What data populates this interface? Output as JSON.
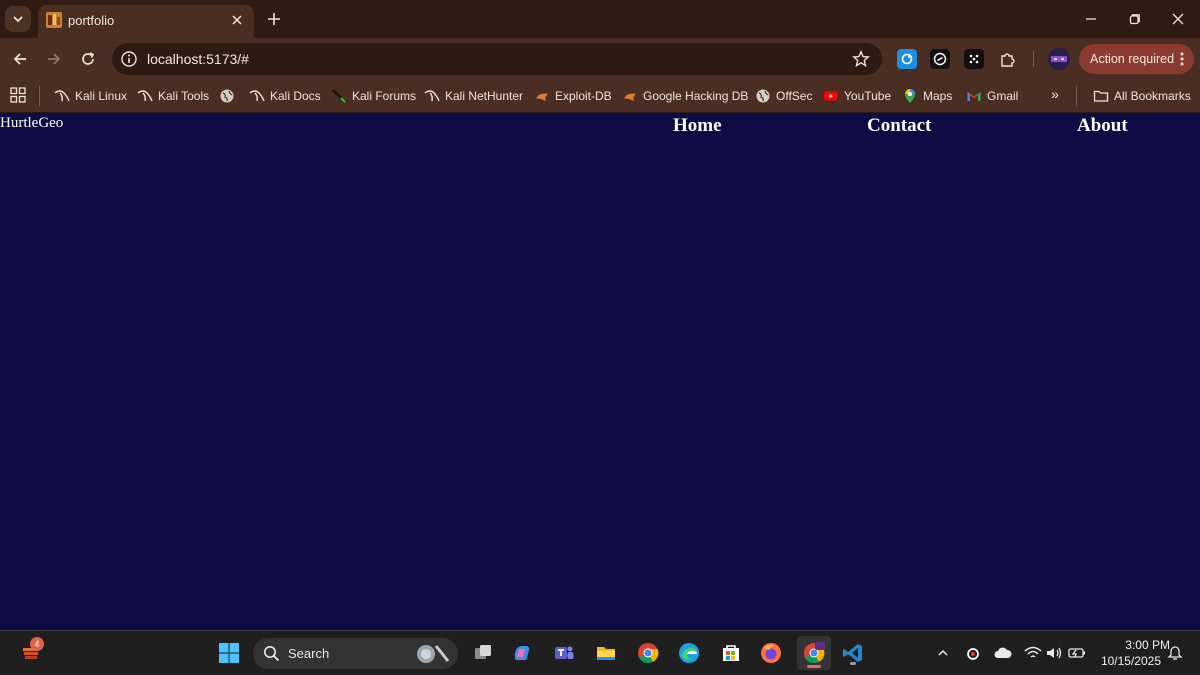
{
  "browser": {
    "tab": {
      "title": "portfolio"
    },
    "url": "localhost:5173/#",
    "action_required_label": "Action required",
    "theme_colors": {
      "frame": "#2f1b14",
      "toolbar": "#4a2e24",
      "action_pill": "#8a3a2e"
    }
  },
  "bookmarks": [
    {
      "label": "Kali Linux",
      "icon": "kali-dragon-icon"
    },
    {
      "label": "Kali Tools",
      "icon": "kali-dragon-icon"
    },
    {
      "label": "",
      "icon": "globe-icon"
    },
    {
      "label": "Kali Docs",
      "icon": "kali-dragon-icon"
    },
    {
      "label": "Kali Forums",
      "icon": "kali-dragon-icon"
    },
    {
      "label": "Kali NetHunter",
      "icon": "kali-dragon-icon"
    },
    {
      "label": "Exploit-DB",
      "icon": "exploit-db-icon"
    },
    {
      "label": "Google Hacking DB",
      "icon": "exploit-db-icon"
    },
    {
      "label": "OffSec",
      "icon": "globe-icon"
    },
    {
      "label": "YouTube",
      "icon": "youtube-icon"
    },
    {
      "label": "Maps",
      "icon": "maps-icon"
    },
    {
      "label": "Gmail",
      "icon": "gmail-icon"
    }
  ],
  "bookmarks_more": "»",
  "all_bookmarks_label": "All Bookmarks",
  "page": {
    "brand": "HurtleGeo",
    "nav": [
      "Home",
      "Contact",
      "About"
    ],
    "background_color": "#0e0c45"
  },
  "taskbar": {
    "search_label": "Search",
    "widget_badge": "4",
    "time": "3:00 PM",
    "date": "10/15/2025"
  }
}
